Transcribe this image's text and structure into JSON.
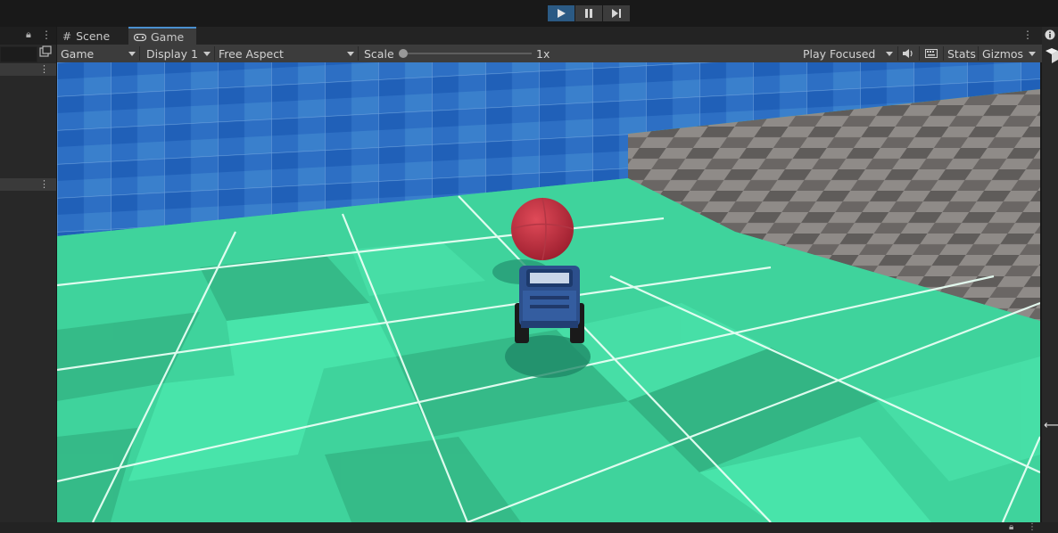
{
  "tabs": {
    "scene_label": "Scene",
    "game_label": "Game"
  },
  "game_toolbar": {
    "view_dropdown": "Game",
    "display_dropdown": "Display 1",
    "aspect_dropdown": "Free Aspect",
    "scale_label": "Scale",
    "scale_value": "1x",
    "play_mode_dropdown": "Play Focused",
    "stats_label": "Stats",
    "gizmos_label": "Gizmos"
  },
  "play_controls": {
    "play_active": true,
    "icons": [
      "play-icon",
      "pause-icon",
      "step-icon"
    ]
  },
  "colors": {
    "active_blue": "#2b5a84",
    "floor_green": "#3cc896",
    "wall_blue": "#2a6fc2",
    "ramp_gray": "#8a8684",
    "ball_red": "#c83040",
    "car_blue": "#2c4f8c"
  }
}
